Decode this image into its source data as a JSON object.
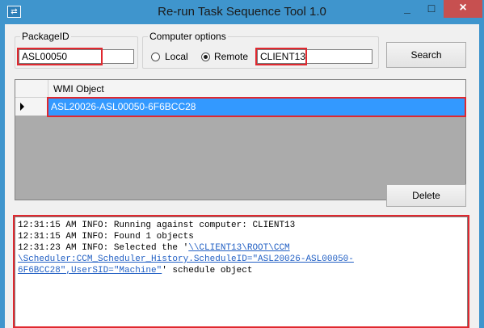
{
  "window": {
    "title": "Re-run Task Sequence Tool 1.0",
    "minimize": "_",
    "maximize": "□",
    "close": "×",
    "icon": "app-icon"
  },
  "package": {
    "legend": "PackageID",
    "value": "ASL00050"
  },
  "computer": {
    "legend": "Computer options",
    "local_label": "Local",
    "remote_label": "Remote",
    "selected": "Remote",
    "value": "CLIENT13"
  },
  "buttons": {
    "search": "Search",
    "delete": "Delete"
  },
  "grid": {
    "column": "WMI Object",
    "rows": [
      "ASL20026-ASL00050-6F6BCC28"
    ]
  },
  "log": {
    "line1": "12:31:15 AM INFO: Running against computer: CLIENT13",
    "line2": "12:31:15 AM INFO: Found 1 objects",
    "line3_prefix": "12:31:23 AM INFO: Selected the '",
    "line3_link": "\\\\CLIENT13\\ROOT\\CCM",
    "line4_link": "\\Scheduler:CCM_Scheduler_History.ScheduleID=\"ASL20026-ASL00050-",
    "line5_link": "6F6BCC28\",UserSID=\"Machine\"",
    "line5_suffix": "' schedule object"
  },
  "colors": {
    "titlebar": "#3f95cd",
    "selection": "#3399ff",
    "highlight": "#e0282f",
    "link": "#2260c4"
  }
}
